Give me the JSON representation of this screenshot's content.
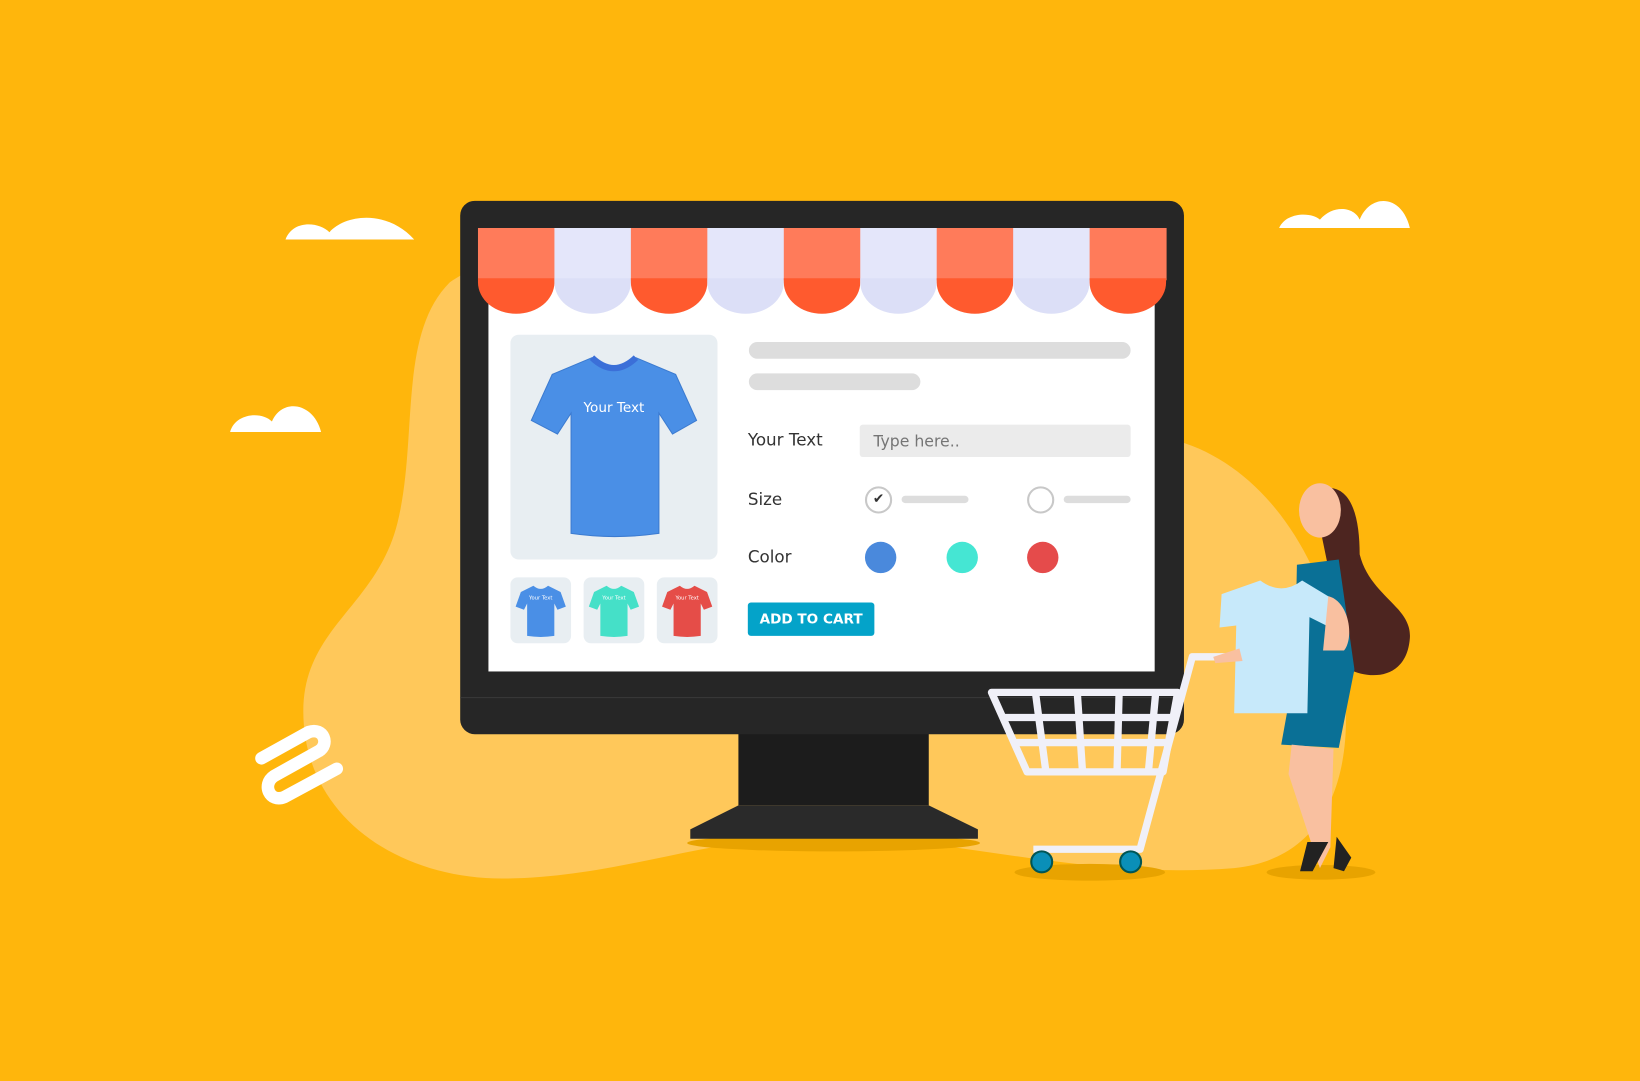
{
  "product": {
    "shirt_print_text": "Your Text",
    "thumbnails": [
      {
        "color": "#4A8FE6",
        "label": "Your Text"
      },
      {
        "color": "#45E0C8",
        "label": "Your Text"
      },
      {
        "color": "#E54D48",
        "label": "Your Text"
      }
    ]
  },
  "form": {
    "text_label": "Your Text",
    "text_placeholder": "Type here..",
    "size_label": "Size",
    "size_options": [
      {
        "selected": true
      },
      {
        "selected": false
      }
    ],
    "color_label": "Color",
    "color_options": [
      "#4A89DC",
      "#45E6D3",
      "#E54B4B"
    ],
    "add_to_cart": "ADD TO CART"
  },
  "colors": {
    "background": "#FFB60C",
    "accent_button": "#04A3C9",
    "awning_orange": "#FF5A2E",
    "awning_lavender": "#E4E6FA"
  }
}
